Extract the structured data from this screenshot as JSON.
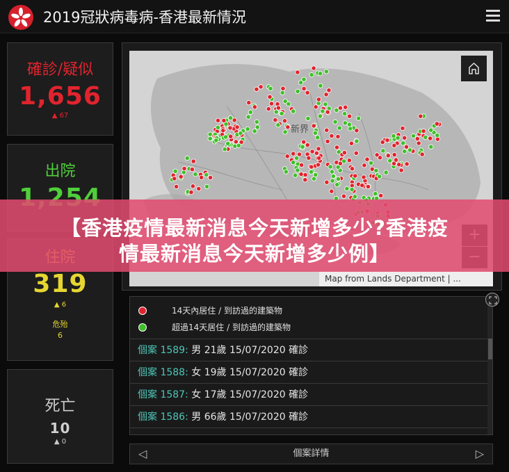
{
  "header": {
    "title": "2019冠狀病毒病-香港最新情況"
  },
  "stats": {
    "confirmed": {
      "label": "確診/疑似",
      "value": "1,656",
      "delta": "▲ 67",
      "color": "#e0242e"
    },
    "discharged": {
      "label": "出院",
      "value": "1,254",
      "color": "#4fcf3a"
    },
    "hospitalized": {
      "label": "住院",
      "value": "319",
      "delta": "▲ 6",
      "critical_label": "危殆",
      "critical_value": "6",
      "color": "#e6d632"
    },
    "deaths": {
      "label": "死亡",
      "value": "10",
      "delta": "▲ 0",
      "color": "#bdbdbd"
    }
  },
  "map": {
    "region_label": "新界",
    "attribution": "Map from Lands Department | ...",
    "zoom_in": "+",
    "zoom_out": "−",
    "marker_colors": {
      "recent": "#e0242e",
      "older": "#3fbf2a"
    }
  },
  "legend": [
    {
      "label": "14天內居住 / 到訪過的建築物",
      "color": "#e0242e"
    },
    {
      "label": "超過14天居住 / 到訪過的建築物",
      "color": "#3fbf2a"
    }
  ],
  "cases": [
    {
      "id": "個案 1589:",
      "detail": "男  21歲  15/07/2020 確診"
    },
    {
      "id": "個案 1588:",
      "detail": "女  19歲  15/07/2020 確診"
    },
    {
      "id": "個案 1587:",
      "detail": "女  17歲  15/07/2020 確診"
    },
    {
      "id": "個案 1586:",
      "detail": "男  66歲  15/07/2020 確診"
    }
  ],
  "pager": {
    "label": "個案詳情"
  },
  "banner": {
    "line1": "【香港疫情最新消息今天新增多少?香港疫",
    "line2": "情最新消息今天新增多少例】"
  }
}
